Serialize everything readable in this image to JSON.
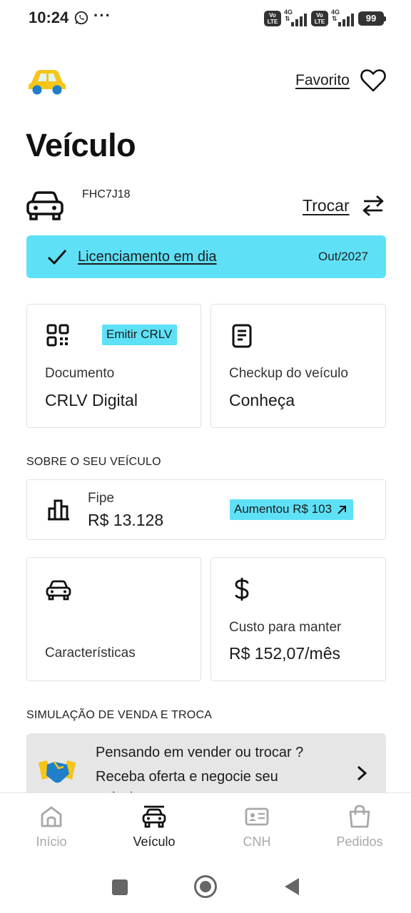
{
  "status_bar": {
    "time": "10:24",
    "more": "···",
    "volte": "Vo LTE",
    "network": "4G",
    "battery": "99"
  },
  "header": {
    "favorite_label": "Favorito"
  },
  "page_title": "Veículo",
  "vehicle": {
    "plate": "FHC7J18",
    "swap_label": "Trocar"
  },
  "licensing": {
    "label": "Licenciamento em dia",
    "valid_until": "Out/2027",
    "color": "#5ee1f7"
  },
  "cards": {
    "document": {
      "tag": "Emitir CRLV",
      "subtitle": "Documento",
      "title": "CRLV Digital"
    },
    "checkup": {
      "subtitle": "Checkup do veículo",
      "title": "Conheça"
    },
    "fipe": {
      "subtitle": "Fipe",
      "title": "R$ 13.128",
      "tag": "Aumentou R$ 103"
    },
    "features": {
      "title": "Características"
    },
    "cost": {
      "subtitle": "Custo para manter",
      "title": "R$ 152,07/mês"
    }
  },
  "sections": {
    "about": "SOBRE O SEU VEÍCULO",
    "simulation": "SIMULAÇÃO DE VENDA E TROCA"
  },
  "simulation": {
    "line1": "Pensando em vender ou trocar ?",
    "line2": "Receba oferta e negocie seu veículo"
  },
  "bottom_nav": {
    "items": [
      {
        "label": "Início",
        "icon": "home-icon",
        "active": false
      },
      {
        "label": "Veículo",
        "icon": "car-icon",
        "active": true
      },
      {
        "label": "CNH",
        "icon": "id-card-icon",
        "active": false
      },
      {
        "label": "Pedidos",
        "icon": "shopping-bag-icon",
        "active": false
      }
    ]
  },
  "colors": {
    "accent": "#5ee1f7",
    "logo_yellow": "#f5c518",
    "logo_blue": "#1f7fc8",
    "inactive_nav": "#a8a8a8"
  }
}
